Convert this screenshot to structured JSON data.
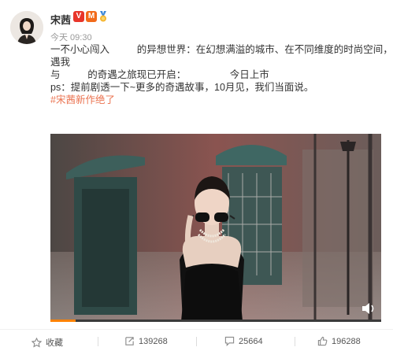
{
  "post": {
    "author": "宋茜",
    "time": "今天 09:30",
    "lines": [
      "一不小心闯入          的异想世界：在幻想满溢的城市、在不同维度的时尚空间，奇",
      "遇我",
      "与          的奇遇之旅现已开启：                今日上市",
      "ps：提前剧透一下~更多的奇遇故事，10月见，我们当面说。"
    ],
    "hashtag": "#宋茜新作绝了"
  },
  "badges": {
    "verified": "V",
    "member": "M"
  },
  "video": {
    "progress": 0.075
  },
  "actions": {
    "favorite_label": "收藏",
    "repost_count": "139268",
    "comment_count": "25664",
    "like_count": "196288"
  },
  "colors": {
    "accent": "#ff8200",
    "hashtag": "#eb7350",
    "verified": "#e8352a"
  }
}
